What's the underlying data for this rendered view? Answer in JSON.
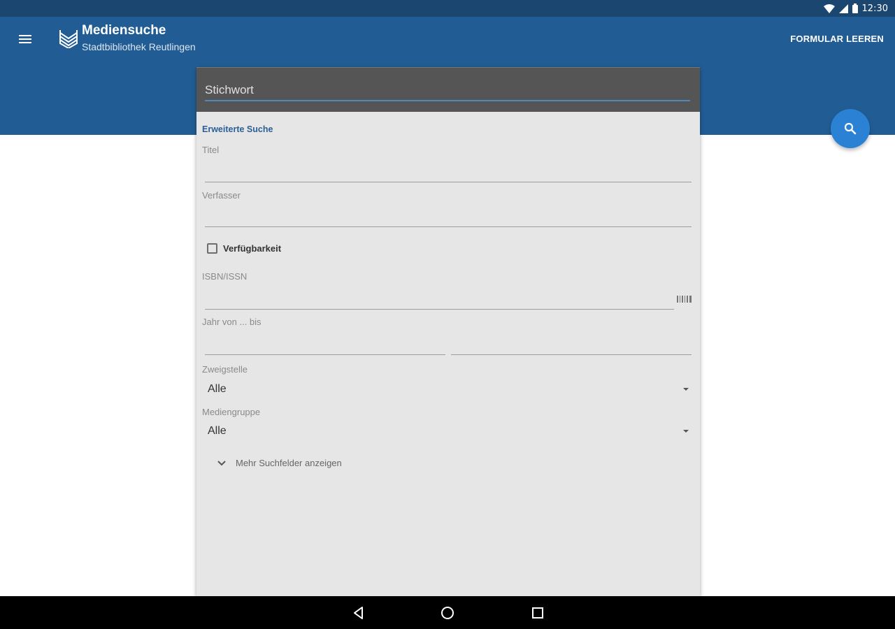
{
  "status_bar": {
    "time": "12:30",
    "icons": [
      "wifi-icon",
      "signal-icon",
      "battery-icon"
    ]
  },
  "app_bar": {
    "title": "Mediensuche",
    "subtitle": "Stadtbibliothek Reutlingen",
    "clear_action": "FORMULAR LEEREN",
    "menu_icon": "hamburger-menu-icon",
    "logo_icon": "library-logo-icon",
    "fab_icon": "search-icon"
  },
  "search_form": {
    "keyword_placeholder": "Stichwort",
    "section_title": "Erweiterte Suche",
    "title_label": "Titel",
    "author_label": "Verfasser",
    "availability_label": "Verfügbarkeit",
    "availability_checked": false,
    "isbn_label": "ISBN/ISSN",
    "isbn_scan_icon": "barcode-icon",
    "year_label": "Jahr von ... bis",
    "branch_label": "Zweigstelle",
    "branch_value": "Alle",
    "media_group_label": "Mediengruppe",
    "media_group_value": "Alle",
    "more_fields_label": "Mehr Suchfelder anzeigen"
  },
  "nav_bar": {
    "icons": [
      "back-icon",
      "home-icon",
      "recents-icon"
    ]
  },
  "colors": {
    "status_bar": "#1b4670",
    "app_bar": "#215d94",
    "fab": "#2b82d4",
    "accent_text": "#2a5f95",
    "card_background": "#e6e6e6",
    "keyword_bar": "#555555"
  }
}
